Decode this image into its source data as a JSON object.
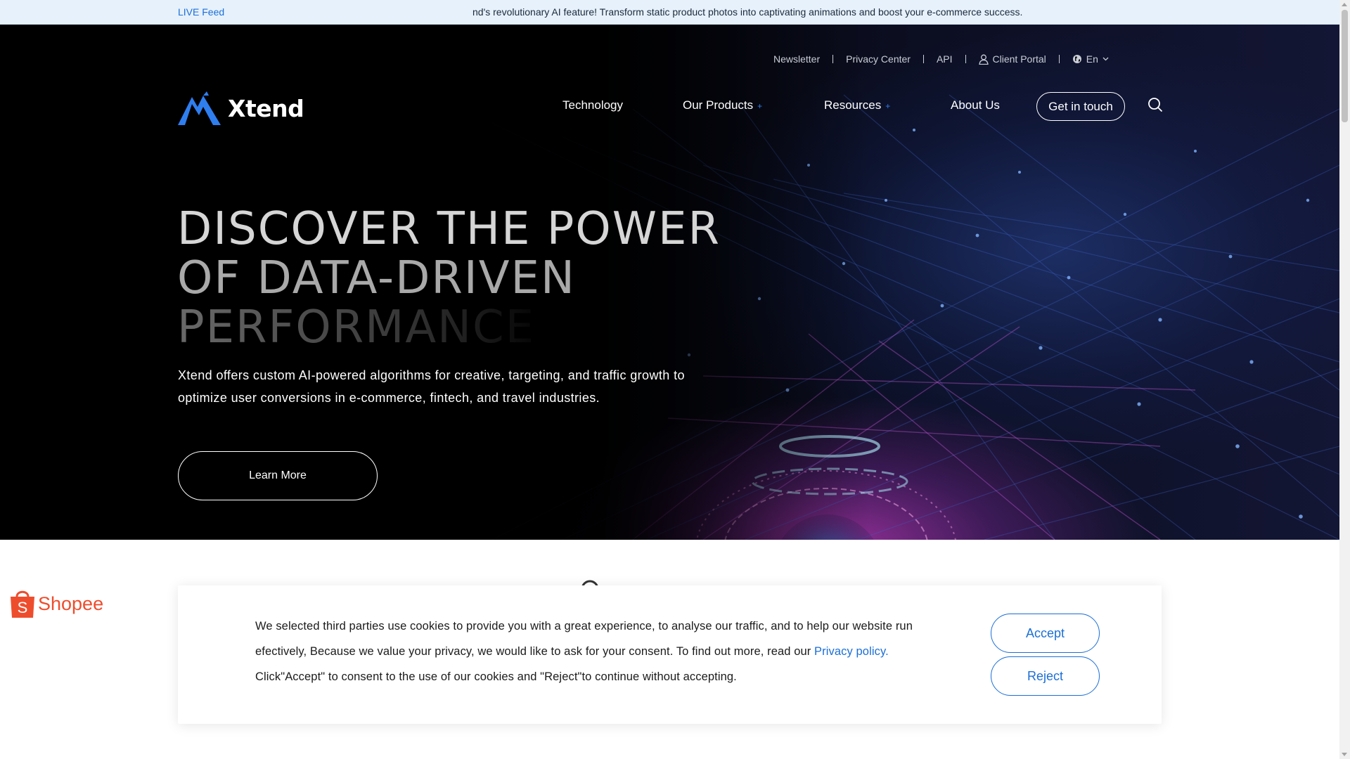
{
  "live_feed": {
    "label": "LIVE Feed",
    "text": "nd's revolutionary AI feature! Transform static product photos into captivating animations and boost your e-commerce success."
  },
  "utility_nav": {
    "newsletter": "Newsletter",
    "privacy_center": "Privacy Center",
    "api": "API",
    "client_portal": "Client Portal",
    "language": "En"
  },
  "brand": {
    "name": "Xtend",
    "accent": "#1b6fd6"
  },
  "main_nav": {
    "technology": "Technology",
    "our_products": "Our Products",
    "resources": "Resources",
    "about_us": "About Us",
    "expand_marker": "+",
    "cta": "Get in touch"
  },
  "hero": {
    "headline_line1": "DISCOVER THE POWER",
    "headline_line2": "OF DATA-DRIVEN",
    "headline_line3": "PERFORMANCE",
    "description": "Xtend offers custom AI-powered algorithms for creative, targeting, and traffic growth to optimize user conversions in e-commerce, fintech, and travel industries.",
    "cta": "Learn More"
  },
  "partners": {
    "shopee": "Shopee"
  },
  "cookie_banner": {
    "text_before_link": "We selected third parties use cookies to provide you with a great experience, to analyse our traffic, and to help our website run efectively, Because we value your privacy, we would like to ask for your consent. To find out more, read our ",
    "link": "Privacy policy.",
    "text_after_link": " Click\"Accept\" to consent to the use of our cookies and \"Reject\"to continue without accepting.",
    "accept": "Accept",
    "reject": "Reject"
  },
  "colors": {
    "live_bar_bg": "#e6f1fc",
    "hero_bg": "#000000",
    "accent_blue": "#1b6fd6",
    "shopee_orange": "#ee4d2d"
  }
}
